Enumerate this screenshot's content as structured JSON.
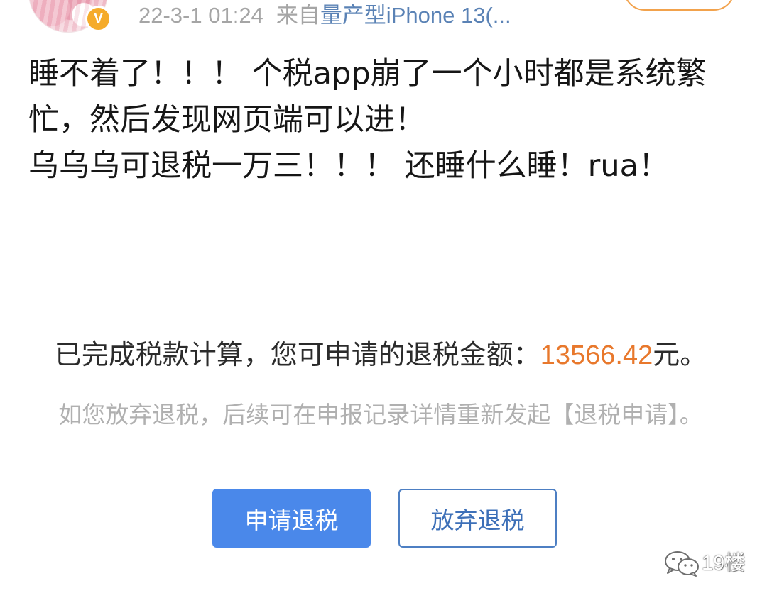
{
  "post": {
    "author": {
      "avatar_icon": "avatar-image",
      "verified_badge": "V"
    },
    "meta": {
      "time": "22-3-1 01:24",
      "from_prefix": "来自",
      "source": "量产型iPhone 13(..."
    },
    "text_lines": [
      "睡不着了！！！ 个税app崩了一个小时都是系统繁",
      "忙，然后发现网页端可以进！",
      "乌乌乌可退税一万三！！！ 还睡什么睡！rua！"
    ]
  },
  "embedded_image": {
    "result_prefix": "已完成税款计算，您可申请的退税金额：",
    "refund_amount": "13566.42",
    "result_suffix": "元。",
    "note": "如您放弃退税，后续可在申报记录详情重新发起【退税申请】。",
    "apply_button": "申请退税",
    "abandon_button": "放弃退税"
  },
  "watermark": {
    "icon": "wechat-icon",
    "text": "19楼"
  },
  "colors": {
    "text": "#161616",
    "meta_gray": "#a5a5a5",
    "source_blue": "#5a82b5",
    "amount_orange": "#e8782c",
    "note_gray": "#b0b0b0",
    "primary_blue": "#4a88ea",
    "outline_blue": "#4d7fc3",
    "follow_orange": "#f2a24c",
    "badge_yellow": "#f5ab2b"
  }
}
